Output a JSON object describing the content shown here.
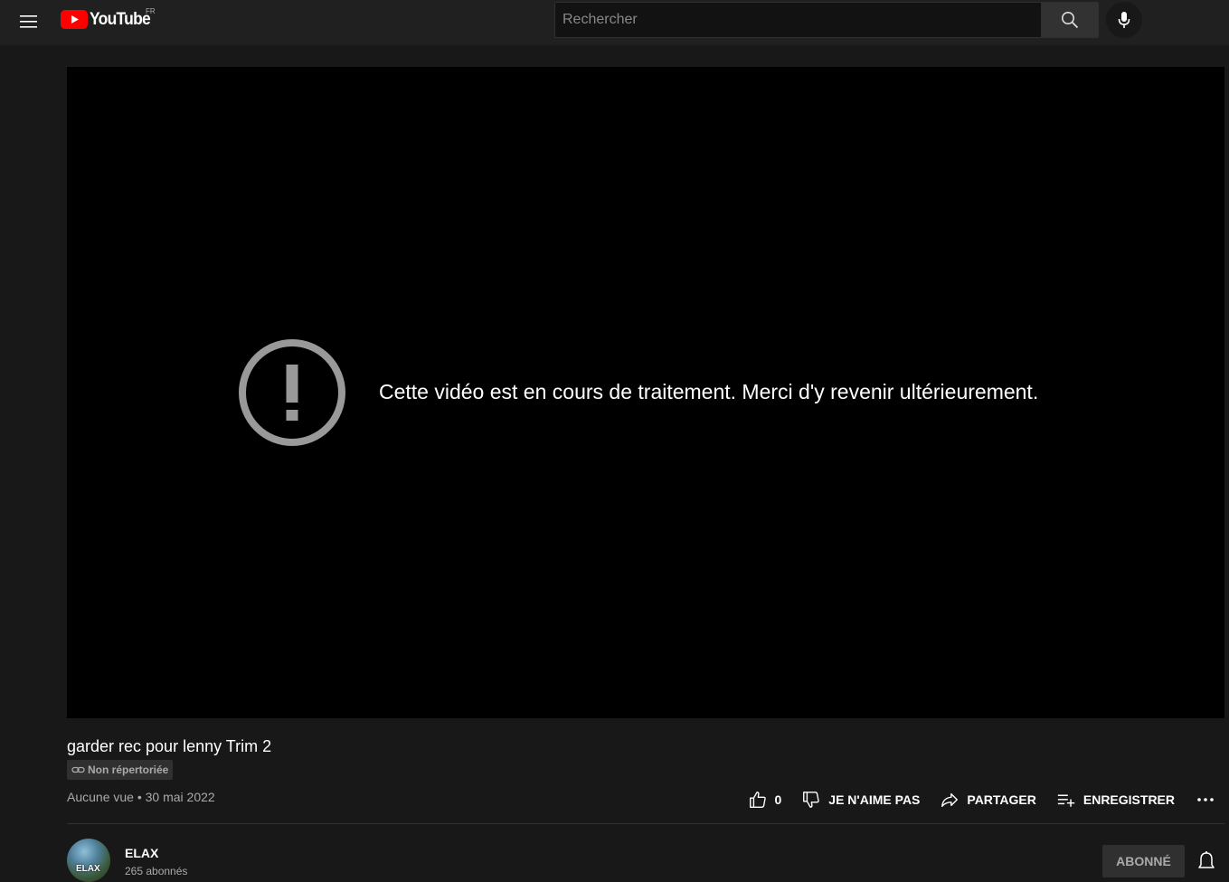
{
  "header": {
    "logo_text": "YouTube",
    "country_code": "FR",
    "search_placeholder": "Rechercher",
    "icons": [
      "menu-icon",
      "youtube-play-icon",
      "search-icon",
      "mic-icon"
    ]
  },
  "player": {
    "error_message": "Cette vidéo est en cours de traitement. Merci d'y revenir ultérieurement.",
    "error_icon": "exclamation-circle-icon"
  },
  "video": {
    "title": "garder rec pour lenny Trim 2",
    "visibility_badge": "Non répertoriée",
    "meta": "Aucune vue • 30 mai 2022"
  },
  "actions": {
    "like_count": "0",
    "dislike_label": "JE N'AIME PAS",
    "share_label": "PARTAGER",
    "save_label": "ENREGISTRER"
  },
  "channel": {
    "name": "ELAX",
    "subscribers": "265 abonnés",
    "subscribe_label": "ABONNÉ",
    "avatar_text": "ELAX"
  },
  "colors": {
    "background": "#181818",
    "header": "#202020",
    "brand_red": "#ff0000"
  }
}
